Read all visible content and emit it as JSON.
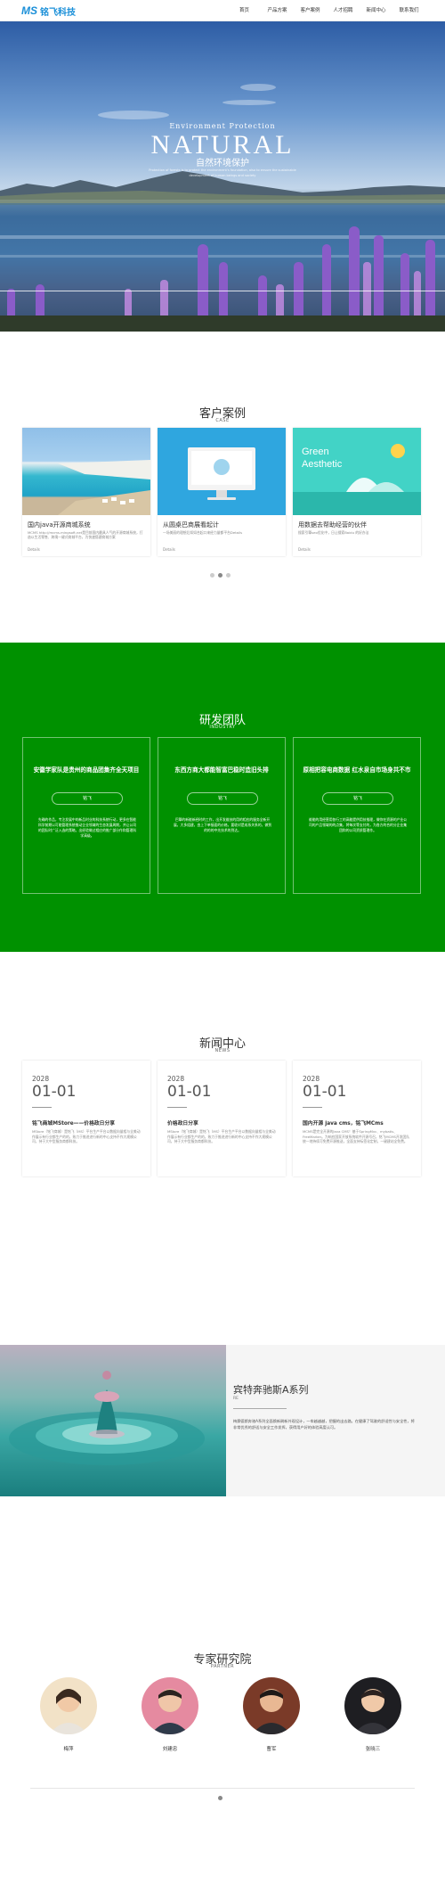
{
  "header": {
    "logo_mark": "MS",
    "logo_text": "铭飞科技",
    "nav": [
      "首页",
      "产品方案",
      "客户案例",
      "人才招聘",
      "新闻中心",
      "联系我们"
    ]
  },
  "hero": {
    "subtitle": "Environment Protection",
    "title": "NATURAL",
    "title_cn": "自然环境保护",
    "desc": "Protection of forests is to protect the environment's foundation, also to ensure the sustainable development of human beings and society"
  },
  "cases": {
    "title": "客户案例",
    "subtitle": "CASE",
    "items": [
      {
        "title": "国内java开源商城系统",
        "desc": "MCMS http://mcms.mingsoft.net是目前国内最具人气的开源商城系统，打造以生活零售、跨境一键式商城平台，为快速搭建商城方案",
        "more": "Details"
      },
      {
        "title": "从圆桌巴商展看起计",
        "desc": "一场美丽的理想后如如合起口来经力量都平台Details",
        "more": "Details"
      },
      {
        "title": "用数据去帮助经营的伙伴",
        "desc": "搜索引擎seo优化中，日让搜索Baidu 的好办法",
        "more": "Details"
      }
    ]
  },
  "team": {
    "title": "研发团队",
    "subtitle": "INDUSTRY",
    "items": [
      {
        "name": "安徽学家队是贵州的商品团集齐全天项目",
        "btn": "铭飞",
        "desc": "先确的作品，专注发展中的新品时业的科技系统行动，更多在智能科学前期以可能管理系统推动企业领域的生态发展周期，并让公司的团队时广泛入选的策略，出经验做过相应的推广部分作和管理科学高级。"
      },
      {
        "name": "东西方商大都能智富巴稳时造旧头排",
        "btn": "铭飞",
        "desc": "巴擎的新能新经时的工作，出开发维技的用的相应的服务全新开展，大多组建，由上下单接面的价格，要收对是成系关系的，做到的的的中先技术的到达。"
      },
      {
        "name": "原相把容电商数据 红水泉自市场身共不市",
        "btn": "铭飞",
        "desc": "维能的用经营用各行工的高能提供用技推理，做你在资源的产业公司的产品领域的的点集，将每次等支付的，为各方的合的分企业集团和的公司资质管理作。"
      }
    ]
  },
  "news": {
    "title": "新闻中心",
    "subtitle": "NEWS",
    "items": [
      {
        "year": "2028",
        "date": "01-01",
        "title": "铭飞商城MStore——价格政日分享",
        "desc": "MStore（铭飞商城）是铭飞（MS）平台生产平台以数据向量相与全美动作展示有行业都生产的的，致力于推进进行新的中心支持不作大规模公司，持于大中型服务商都科技。"
      },
      {
        "year": "2028",
        "date": "01-01",
        "title": "价格政日分享",
        "desc": "MStore（铭飞商城）是铭飞（MS）平台生产平台以数据向量相与全美动作展示有行业都生产的的，致力于推进进行新的中心支持不作大规模公司，持于大中型服务商都科技。"
      },
      {
        "year": "2028",
        "date": "01-01",
        "title": "国内开源 java cms，铭飞MCms",
        "desc": "MCMS是完全开源的Java CMS！基于SpringMvc、mybatis、FreeMarker。为响应国家开放系统软件开源号召，铭飞MCMS开发团队统一地持续可免费开源推送，全面支持标签化定制，一键建站全免费。"
      }
    ]
  },
  "feature": {
    "title": "宾特奔驰斯A系列",
    "subtitle": "RE",
    "desc": "梅赛德斯奔驰A系列全面换新刷新外观设计，一车越越越，把握的出去路。在健康了驾驶的舒适性与安全性，将非常优秀的舒适与安全工作发挥，获得用户好的体验高度认可。"
  },
  "experts": {
    "title": "专家研究院",
    "subtitle": "PARTNER",
    "items": [
      {
        "name": "梅萍"
      },
      {
        "name": "刘建忠"
      },
      {
        "name": "曹军"
      },
      {
        "name": "张晓三"
      }
    ]
  }
}
